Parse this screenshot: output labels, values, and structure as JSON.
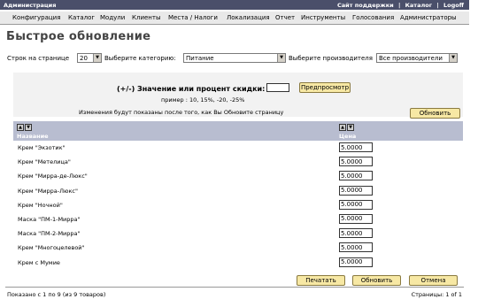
{
  "topbar": {
    "admin_label": "Администрация",
    "support_link": "Сайт поддержки",
    "catalog_link": "Каталог",
    "logoff_link": "Logoff",
    "separator": "|"
  },
  "menu": [
    "Конфигурация",
    "Каталог",
    "Модули",
    "Клиенты",
    "Места / Налоги",
    "Локализация",
    "Отчет",
    "Инструменты",
    "Голосования",
    "Администраторы"
  ],
  "page_title": "Быстрое обновление",
  "filters": {
    "rows_label": "Строк на странице",
    "rows_value": "20",
    "category_label": "Выберите категорию:",
    "category_value": "Питание",
    "manufacturer_label": "Выберите производителя",
    "manufacturer_value": "Все производители"
  },
  "discount": {
    "label": "(+/-) Значение или процент скидки:",
    "value": "",
    "preview_button": "Предпросмотр",
    "example": "пример : 10, 15%, -20, -25%",
    "note": "Изменения будут показаны после того, как Вы Обновите страницу",
    "update_button": "Обновить"
  },
  "table": {
    "col_name": "Название",
    "col_price": "Цена",
    "rows": [
      {
        "name": "Крем \"Экзотик\"",
        "price": "5.0000"
      },
      {
        "name": "Крем \"Метелица\"",
        "price": "5.0000"
      },
      {
        "name": "Крем \"Мирра-де-Люкс\"",
        "price": "5.0000"
      },
      {
        "name": "Крем \"Мирра-Люкс\"",
        "price": "5.0000"
      },
      {
        "name": "Крем \"Ночной\"",
        "price": "5.0000"
      },
      {
        "name": "Маска \"ПМ-1-Мирра\"",
        "price": "5.0000"
      },
      {
        "name": "Маска \"ПМ-2-Мирра\"",
        "price": "5.0000"
      },
      {
        "name": "Крем \"Многоцелевой\"",
        "price": "5.0000"
      },
      {
        "name": "Крем с Мумие",
        "price": "5.0000"
      }
    ]
  },
  "actions": {
    "print": "Печатать",
    "update": "Обновить",
    "cancel": "Отмена"
  },
  "footer": {
    "count_text": "Показано с 1 по 9 (из 9 товаров)",
    "pages_text": "Страницы: 1 of 1"
  },
  "colors": {
    "topbar": "#4a4f6a",
    "header_row": "#b8bdd0",
    "button": "#f7e8a4"
  }
}
